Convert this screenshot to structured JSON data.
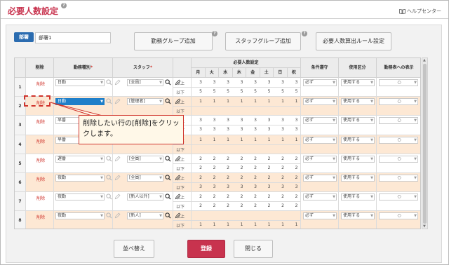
{
  "header": {
    "title": "必要人数設定",
    "help_label": "ヘルプセンター"
  },
  "department": {
    "badge": "部署",
    "value": "部署1"
  },
  "toolbar": {
    "group_add": "勤務グループ追加",
    "staff_group_add": "スタッフグループ追加",
    "rule_setting": "必要人数算出ルール設定"
  },
  "table": {
    "headers": {
      "delete": "削除",
      "shift_type": "勤務種別",
      "staff": "スタッフ",
      "required": "必要人数設定",
      "condition": "条件遵守",
      "usage": "使用区分",
      "display": "勤務表への表示",
      "required_mark": "*"
    },
    "days": [
      "月",
      "火",
      "水",
      "木",
      "金",
      "土",
      "日",
      "祝"
    ],
    "bound_labels": {
      "upper": "以上",
      "lower": "以下"
    },
    "rows": [
      {
        "no": "1",
        "delete": "削除",
        "shift": "日勤",
        "staff": "[全員]",
        "upper": [
          "3",
          "3",
          "3",
          "3",
          "3",
          "3",
          "3",
          "3"
        ],
        "lower": [
          "5",
          "5",
          "5",
          "5",
          "5",
          "5",
          "5",
          "5"
        ],
        "condition": "必ず",
        "usage": "使用する",
        "display": "○",
        "alt": false
      },
      {
        "no": "2",
        "delete": "削除",
        "shift": "日勤",
        "staff": "[管理者]",
        "upper": [
          "1",
          "1",
          "1",
          "1",
          "1",
          "1",
          "1",
          "1"
        ],
        "lower": [
          "",
          "",
          "",
          "",
          "",
          "",
          "",
          ""
        ],
        "condition": "必ず",
        "usage": "使用する",
        "display": "○",
        "alt": true
      },
      {
        "no": "3",
        "delete": "削除",
        "shift": "早番",
        "staff": "",
        "upper": [
          "3",
          "3",
          "3",
          "3",
          "3",
          "3",
          "3",
          "3"
        ],
        "lower": [
          "3",
          "3",
          "3",
          "3",
          "3",
          "3",
          "3",
          "3"
        ],
        "condition": "必ず",
        "usage": "使用する",
        "display": "○",
        "alt": false
      },
      {
        "no": "4",
        "delete": "削除",
        "shift": "早番",
        "staff": "",
        "upper": [
          "1",
          "1",
          "1",
          "1",
          "1",
          "1",
          "1",
          "1"
        ],
        "lower": [
          "",
          "",
          "",
          "",
          "",
          "",
          "",
          ""
        ],
        "condition": "必ず",
        "usage": "使用する",
        "display": "○",
        "alt": true
      },
      {
        "no": "5",
        "delete": "削除",
        "shift": "遅番",
        "staff": "[全員]",
        "upper": [
          "2",
          "2",
          "2",
          "2",
          "2",
          "2",
          "2",
          "2"
        ],
        "lower": [
          "2",
          "2",
          "2",
          "2",
          "2",
          "2",
          "2",
          "2"
        ],
        "condition": "必ず",
        "usage": "使用する",
        "display": "○",
        "alt": false
      },
      {
        "no": "6",
        "delete": "削除",
        "shift": "夜勤",
        "staff": "[全員]",
        "upper": [
          "2",
          "2",
          "2",
          "2",
          "2",
          "2",
          "2",
          "2"
        ],
        "lower": [
          "3",
          "3",
          "3",
          "3",
          "3",
          "3",
          "3",
          "3"
        ],
        "condition": "必ず",
        "usage": "使用する",
        "display": "○",
        "alt": true
      },
      {
        "no": "7",
        "delete": "削除",
        "shift": "夜勤",
        "staff": "[新人以外]",
        "upper": [
          "2",
          "2",
          "2",
          "2",
          "2",
          "2",
          "2",
          "2"
        ],
        "lower": [
          "2",
          "2",
          "2",
          "2",
          "2",
          "2",
          "2",
          "2"
        ],
        "condition": "必ず",
        "usage": "使用する",
        "display": "○",
        "alt": false
      },
      {
        "no": "8",
        "delete": "削除",
        "shift": "夜勤",
        "staff": "[新人]",
        "upper": [
          "",
          "",
          "",
          "",
          "",
          "",
          "",
          ""
        ],
        "lower": [
          "1",
          "1",
          "1",
          "1",
          "1",
          "1",
          "1",
          "1"
        ],
        "condition": "必ず",
        "usage": "使用する",
        "display": "○",
        "alt": true
      }
    ]
  },
  "footer": {
    "sort": "並べ替え",
    "register": "登録",
    "close": "閉じる"
  },
  "callout": {
    "text": "削除したい行の[削除]をクリックします。"
  },
  "colors": {
    "accent": "#c8334e",
    "alt_row": "#fde8d4",
    "highlight": "#1f7fc9",
    "annotation": "#d0342c"
  }
}
